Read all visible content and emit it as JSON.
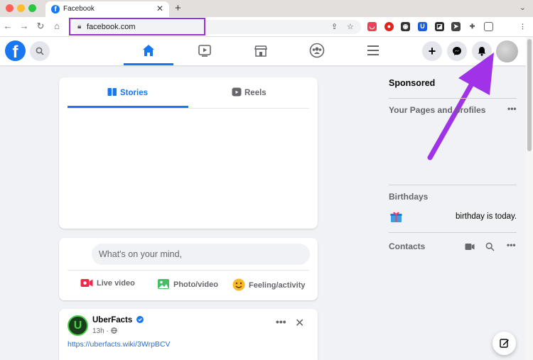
{
  "browser": {
    "tab_title": "Facebook",
    "tab_favicon_letter": "f",
    "url": "facebook.com",
    "colors": {
      "highlight": "#9b30d9",
      "fb_blue": "#1877f2"
    }
  },
  "header": {
    "logo_letter": "f",
    "nav_tabs": [
      "home",
      "watch",
      "marketplace",
      "groups",
      "menu"
    ]
  },
  "stories_card": {
    "tabs": [
      {
        "label": "Stories"
      },
      {
        "label": "Reels"
      }
    ]
  },
  "composer": {
    "placeholder": "What's on your mind,",
    "actions": [
      {
        "label": "Live video",
        "icon": "live-video-icon",
        "color": "#f02849"
      },
      {
        "label": "Photo/video",
        "icon": "photo-icon",
        "color": "#45bd62"
      },
      {
        "label": "Feeling/activity",
        "icon": "feeling-icon",
        "color": "#f7b928"
      }
    ]
  },
  "post": {
    "author": "UberFacts",
    "time": "13h",
    "link": "https://uberfacts.wiki/3WrpBCV"
  },
  "right_column": {
    "sponsored": "Sponsored",
    "pages_heading": "Your Pages and profiles",
    "birthdays_heading": "Birthdays",
    "birthday_text": "birthday is today.",
    "contacts_heading": "Contacts"
  }
}
